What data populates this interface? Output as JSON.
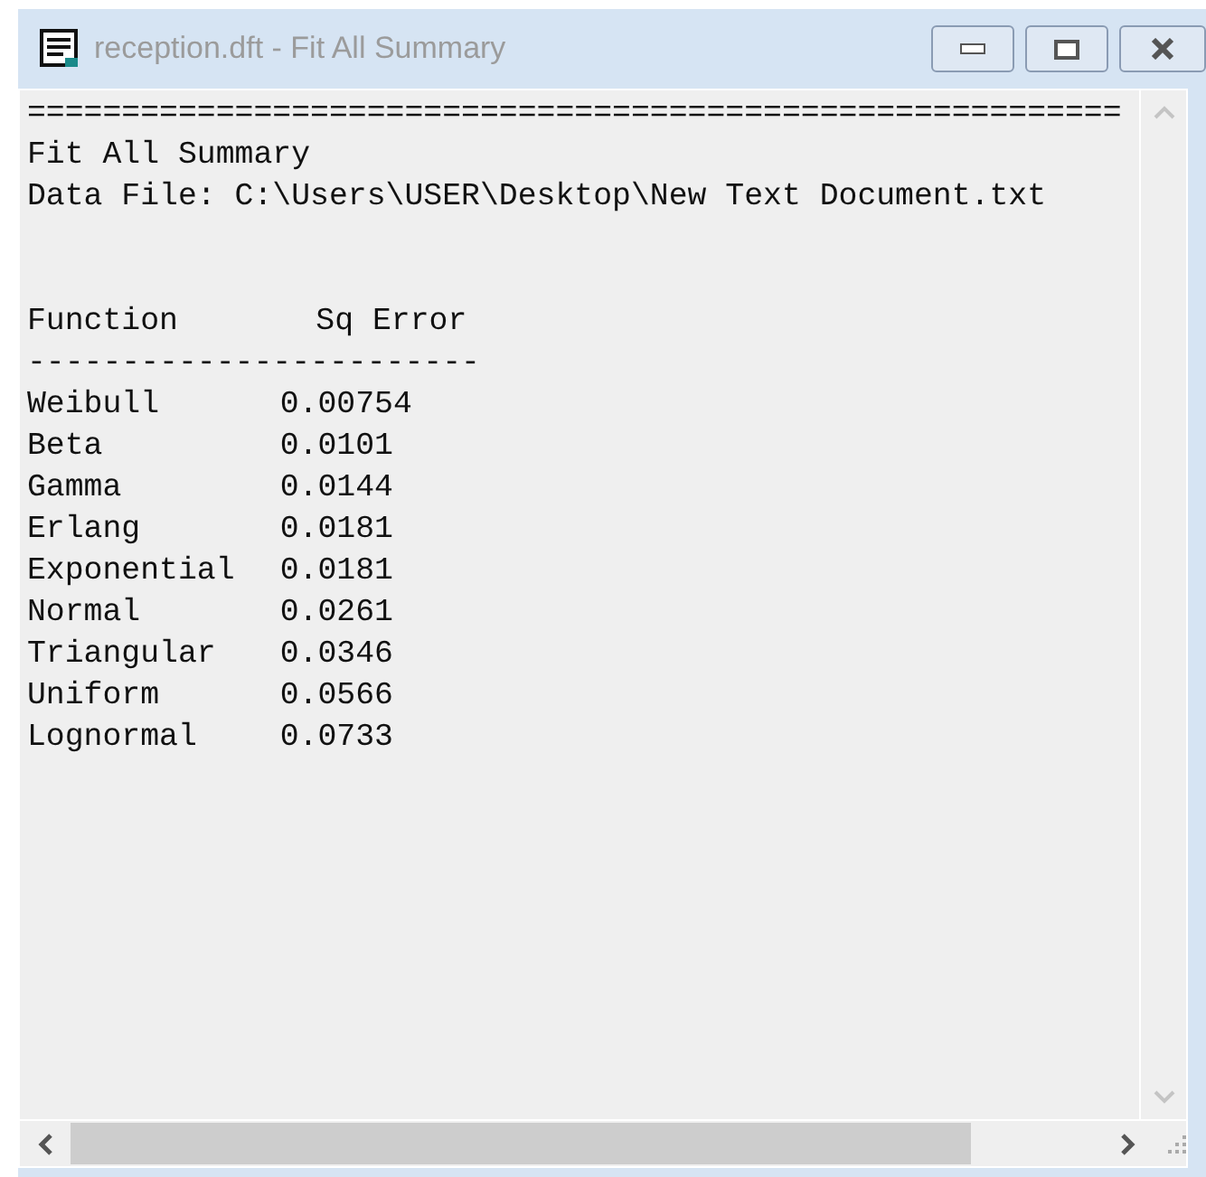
{
  "window": {
    "title": "reception.dft - Fit All Summary"
  },
  "report": {
    "rule": "==========================================================",
    "title": "Fit All Summary",
    "data_file": "Data File: C:\\Users\\USER\\Desktop\\New Text Document.txt",
    "columns": [
      "Function",
      "Sq Error"
    ],
    "separator": "------------------------",
    "rows": [
      {
        "function": "Weibull",
        "sq_error": "0.00754"
      },
      {
        "function": "Beta",
        "sq_error": "0.0101"
      },
      {
        "function": "Gamma",
        "sq_error": "0.0144"
      },
      {
        "function": "Erlang",
        "sq_error": "0.0181"
      },
      {
        "function": "Exponential",
        "sq_error": "0.0181"
      },
      {
        "function": "Normal",
        "sq_error": "0.0261"
      },
      {
        "function": "Triangular",
        "sq_error": "0.0346"
      },
      {
        "function": "Uniform",
        "sq_error": "0.0566"
      },
      {
        "function": "Lognormal",
        "sq_error": "0.0733"
      }
    ]
  }
}
